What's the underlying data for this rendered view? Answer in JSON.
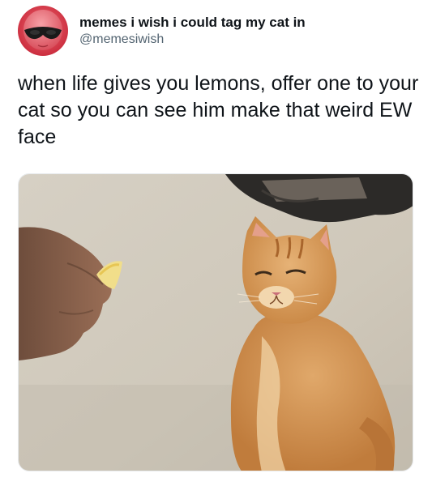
{
  "account": {
    "display_name": "memes i wish i could tag my cat in",
    "handle": "@memesiwish",
    "avatar_icon": "alien-head-sunglasses-avatar",
    "avatar_color": "#d8404f"
  },
  "tweet": {
    "text": "when life gives you lemons, offer one to your cat so you can see him make that weird EW face"
  },
  "media": {
    "content": "photo-hand-offering-lemon-to-orange-cat"
  }
}
